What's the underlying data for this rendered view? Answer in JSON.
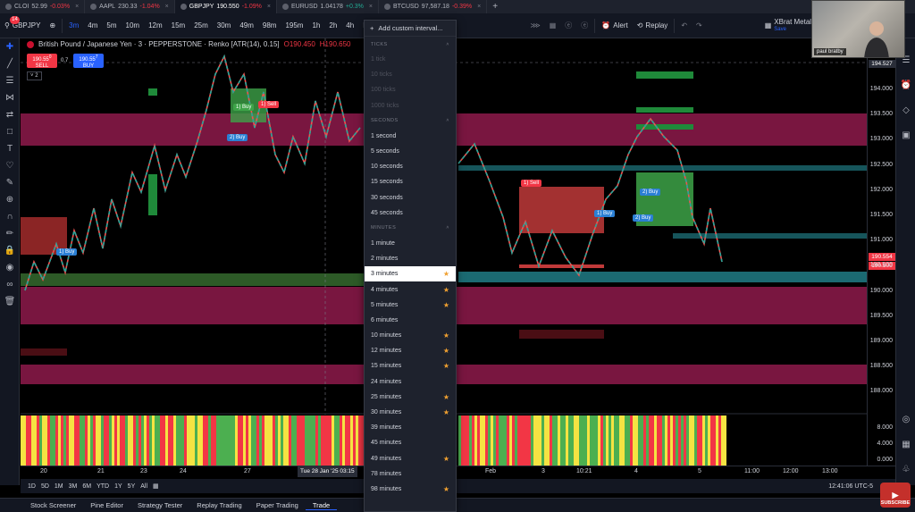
{
  "tabs": [
    {
      "symbol": "CLOI",
      "price": "52.99",
      "change": "-0.03%",
      "dir": "neg"
    },
    {
      "symbol": "AAPL",
      "price": "230.33",
      "change": "-1.04%",
      "dir": "neg"
    },
    {
      "symbol": "GBPJPY",
      "price": "190.550",
      "change": "-1.09%",
      "dir": "neg",
      "active": true
    },
    {
      "symbol": "EURUSD",
      "price": "1.04178",
      "change": "+0.3%",
      "dir": "pos"
    },
    {
      "symbol": "BTCUSD",
      "price": "97,587.18",
      "change": "-0.39%",
      "dir": "neg"
    }
  ],
  "toolbar": {
    "symbol": "GBPJPY",
    "intervals": [
      "3m",
      "4m",
      "5m",
      "10m",
      "12m",
      "15m",
      "25m",
      "30m",
      "49m",
      "98m",
      "195m",
      "1h",
      "2h",
      "4h",
      "D",
      "W",
      "1m"
    ],
    "selected_interval": "3m",
    "alert": "Alert",
    "replay": "Replay",
    "layout_name": "XBrat Metals ...",
    "layout_sub": "Save"
  },
  "notification_count": "14",
  "legend": {
    "title": "British Pound / Japanese Yen · 3 · PEPPERSTONE · Renko [ATR(14), 0.15]",
    "o_value": "O190.450",
    "h_value": "H190.650"
  },
  "trade": {
    "sell_price": "190.55",
    "sell_suffix": "0",
    "sell_label": "SELL",
    "spread": "0.7",
    "buy_price": "190.55",
    "buy_suffix": "7",
    "buy_label": "BUY",
    "indicator_count": "2"
  },
  "price_axis": {
    "ticks": [
      "194.000",
      "193.500",
      "193.000",
      "192.500",
      "192.000",
      "191.500",
      "191.000",
      "190.500",
      "190.000",
      "189.500",
      "189.000",
      "188.500",
      "188.000"
    ],
    "top_badge": "194.527",
    "badge_1": "190.554",
    "badge_2": "190.500",
    "osc_ticks": [
      "8.000",
      "4.000",
      "0.000"
    ]
  },
  "tags": {
    "buy1": "1) Buy",
    "buy2": "2) Buy",
    "sell1": "1) Sell",
    "buy3": "1) Buy",
    "sell2": "1) Sell",
    "buy4": "1) Buy",
    "buy5": "2) Buy"
  },
  "time_axis": {
    "labels": [
      "20",
      "21",
      "23",
      "24",
      "27",
      "Feb",
      "3",
      "10:21",
      "4",
      "5",
      "11:00",
      "12:00",
      "13:00"
    ],
    "crosshair": "Tue 28 Jan '25  03:15"
  },
  "dropdown": {
    "add_label": "Add custom interval...",
    "ticks_head": "TICKS",
    "ticks": [
      "1 tick",
      "10 ticks",
      "100 ticks",
      "1000 ticks"
    ],
    "seconds_head": "SECONDS",
    "seconds": [
      "1 second",
      "5 seconds",
      "10 seconds",
      "15 seconds",
      "30 seconds",
      "45 seconds"
    ],
    "minutes_head": "MINUTES",
    "minutes": [
      {
        "label": "1 minute",
        "fav": false
      },
      {
        "label": "2 minutes",
        "fav": false
      },
      {
        "label": "3 minutes",
        "fav": true,
        "selected": true
      },
      {
        "label": "4 minutes",
        "fav": true
      },
      {
        "label": "5 minutes",
        "fav": true
      },
      {
        "label": "6 minutes",
        "fav": false
      },
      {
        "label": "10 minutes",
        "fav": true
      },
      {
        "label": "12 minutes",
        "fav": true
      },
      {
        "label": "15 minutes",
        "fav": true
      },
      {
        "label": "24 minutes",
        "fav": false
      },
      {
        "label": "25 minutes",
        "fav": true
      },
      {
        "label": "30 minutes",
        "fav": true
      },
      {
        "label": "39 minutes",
        "fav": false
      },
      {
        "label": "45 minutes",
        "fav": false
      },
      {
        "label": "49 minutes",
        "fav": true
      },
      {
        "label": "78 minutes",
        "fav": false
      },
      {
        "label": "98 minutes",
        "fav": true
      }
    ]
  },
  "ranges": [
    "1D",
    "5D",
    "1M",
    "3M",
    "6M",
    "YTD",
    "1Y",
    "5Y",
    "All"
  ],
  "clock": "12:41:06 UTC-5",
  "bottom_tabs": [
    "Stock Screener",
    "Pine Editor",
    "Strategy Tester",
    "Replay Trading",
    "Paper Trading",
    "Trade"
  ],
  "webcam_name": "paul bratby",
  "subscribe": "SUBSCRIBE",
  "colors": {
    "up": "#26a69a",
    "down": "#ef5350",
    "zone_magenta": "#8e1a4b",
    "zone_teal": "#1b5e63",
    "accent": "#2962ff"
  }
}
